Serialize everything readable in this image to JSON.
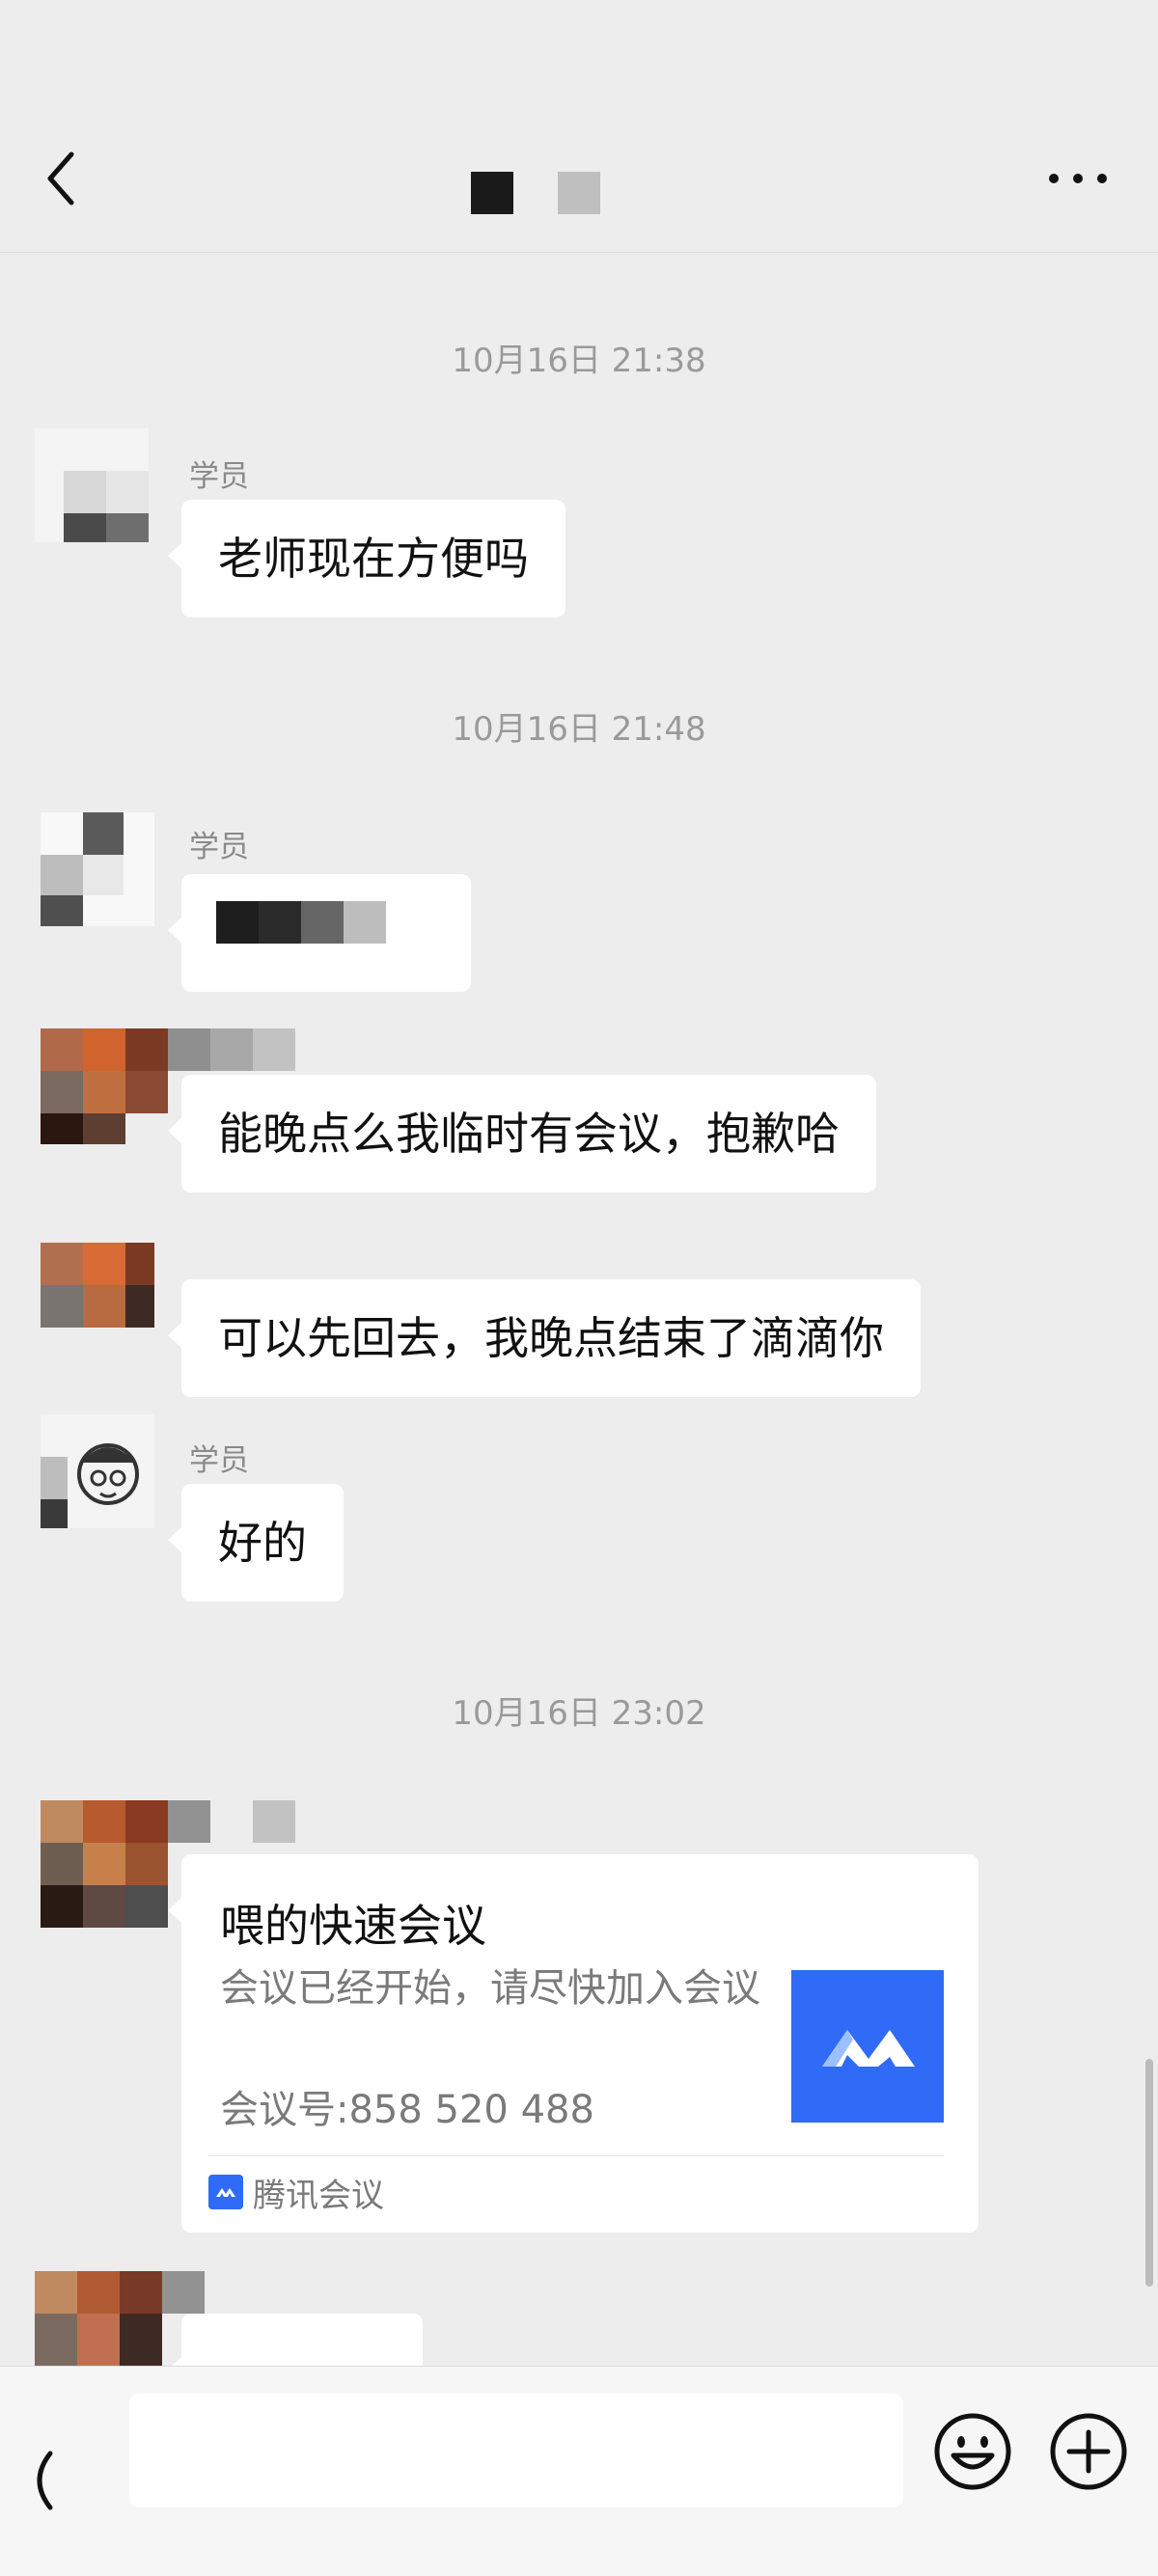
{
  "header": {
    "back_icon": "chevron-left-icon",
    "more_icon": "more-dots-icon"
  },
  "messages": {
    "ts1": "10月16日 21:38",
    "m1_sender": "学员",
    "m1_text": "老师现在方便吗",
    "ts2": "10月16日 21:48",
    "m2_sender": "学员",
    "m3_text": "能晚点么我临时有会议，抱歉哈",
    "m4_text": "可以先回去，我晚点结束了滴滴你",
    "m5_sender": "学员",
    "m5_text": "好的",
    "ts3": "10月16日 23:02"
  },
  "card": {
    "title": "喂的快速会议",
    "description": "会议已经开始，请尽快加入会议",
    "meeting_id": "会议号:858 520 488",
    "source": "腾讯会议"
  },
  "bottom_bar": {
    "voice_icon": "voice-icon",
    "emoji_icon": "emoji-icon",
    "plus_icon": "plus-icon",
    "input_value": ""
  },
  "colors": {
    "background": "#ededed",
    "bubble": "#ffffff",
    "tencent_blue": "#2f6bf6"
  }
}
